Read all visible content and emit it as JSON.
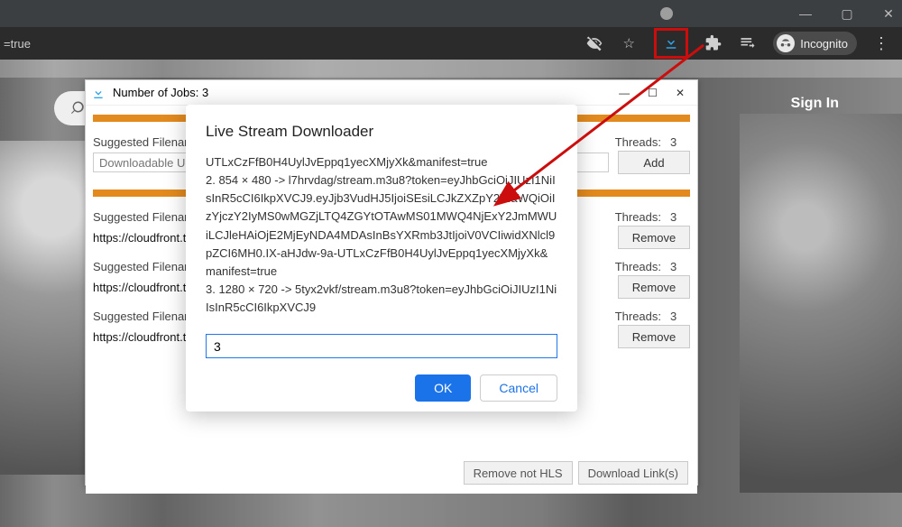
{
  "window": {
    "omnibox_snippet": "=true"
  },
  "toolbar": {
    "incognito_label": "Incognito"
  },
  "page": {
    "signin": "Sign In"
  },
  "panel": {
    "title": "  Number of Jobs: 3",
    "suggested_label": "Suggested Filenam",
    "threads_label": "Threads:",
    "add_label": "Add",
    "remove_label": "Remove",
    "download_url_placeholder": "Downloadable URL",
    "url_trunc": "https://cloudfront.tu",
    "thread_value": "3",
    "btn_remove_not_hls": "Remove not HLS",
    "btn_download_links": "Download Link(s)"
  },
  "modal": {
    "title": "Live Stream Downloader",
    "log_lines": [
      "UTLxCzFfB0H4UylJvEppq1yecXMjyXk&manifest=true",
      "2. 854 × 480 -> l7hrvdag/stream.m3u8?token=eyJhbGciOiJIUzI1NiIsInR5cCI6IkpXVCJ9.eyJjb3VudHJ5IjoiSEsiLCJkZXZpY2VfaWQiOiIzYjczY2IyMS0wMGZjLTQ4ZGYtOTAwMS01MWQ4NjExY2JmMWUiLCJleHAiOjE2MjEyNDA4MDAsInBsYXRmb3JtIjoiV0VCIiwidXNlcl9pZCI6MH0.IX-aHJdw-9a-UTLxCzFfB0H4UylJvEppq1yecXMjyXk&manifest=true",
      "3. 1280 × 720 -> 5tyx2vkf/stream.m3u8?token=eyJhbGciOiJIUzI1NiIsInR5cCI6IkpXVCJ9"
    ],
    "input_value": "3",
    "ok_label": "OK",
    "cancel_label": "Cancel"
  }
}
